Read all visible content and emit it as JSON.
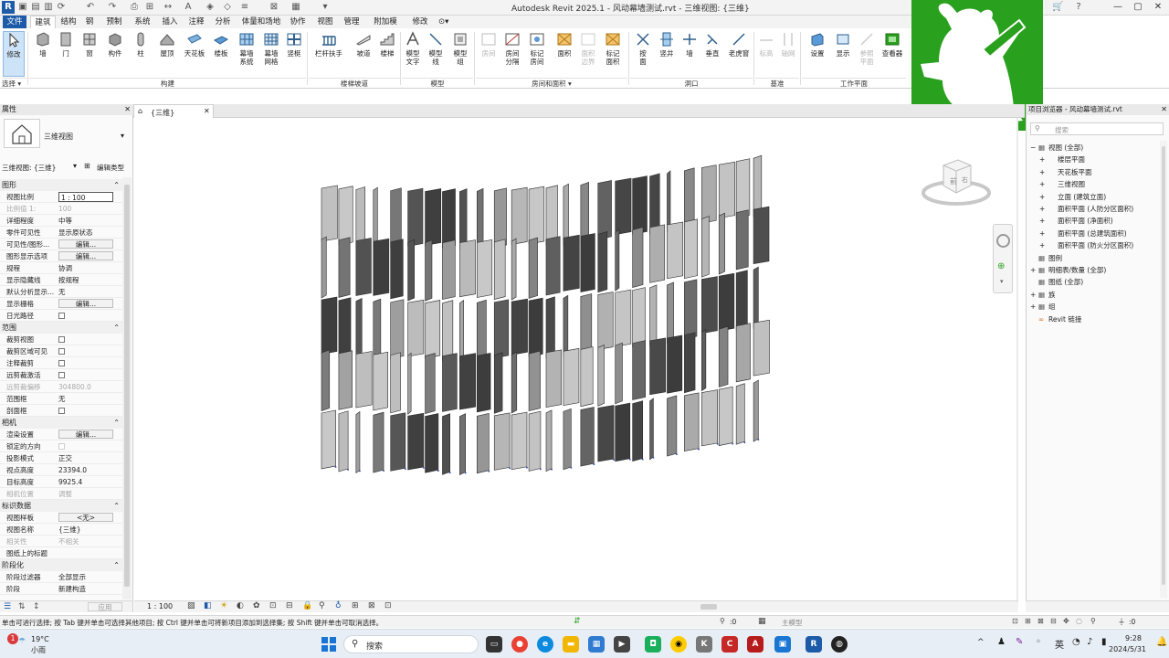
{
  "window": {
    "title": "Autodesk Revit 2025.1 - 风动幕墙测试.rvt - 三维视图: {三维}"
  },
  "menu": {
    "tabs": [
      "文件",
      "建筑",
      "结构",
      "钢",
      "预制",
      "系统",
      "插入",
      "注释",
      "分析",
      "体量和场地",
      "协作",
      "视图",
      "管理",
      "附加模块",
      "修改"
    ]
  },
  "ribbon": {
    "buttons": [
      {
        "label": "修改"
      },
      {
        "label": "墙"
      },
      {
        "label": "门"
      },
      {
        "label": "窗"
      },
      {
        "label": "构件"
      },
      {
        "label": "柱"
      },
      {
        "label": "屋顶"
      },
      {
        "label": "天花板"
      },
      {
        "label": "楼板"
      },
      {
        "label": "幕墙\n系统"
      },
      {
        "label": "幕墙\n网格"
      },
      {
        "label": "竖梃"
      },
      {
        "label": "栏杆扶手"
      },
      {
        "label": "坡道"
      },
      {
        "label": "楼梯"
      },
      {
        "label": "模型\n文字"
      },
      {
        "label": "模型\n线"
      },
      {
        "label": "模型\n组"
      },
      {
        "label": "房间"
      },
      {
        "label": "房间\n分隔"
      },
      {
        "label": "标记\n房间"
      },
      {
        "label": "面积"
      },
      {
        "label": "面积\n边界"
      },
      {
        "label": "标记\n面积"
      },
      {
        "label": "按\n面"
      },
      {
        "label": "竖井"
      },
      {
        "label": "墙"
      },
      {
        "label": "垂直"
      },
      {
        "label": "老虎窗"
      },
      {
        "label": "标高"
      },
      {
        "label": "轴网"
      },
      {
        "label": "设置"
      },
      {
        "label": "显示"
      },
      {
        "label": "参照\n平面"
      },
      {
        "label": "查看器"
      }
    ],
    "panels": [
      {
        "label": "选择 ▾"
      },
      {
        "label": "构建"
      },
      {
        "label": "楼梯坡道"
      },
      {
        "label": "模型"
      },
      {
        "label": "房间和面积 ▾"
      },
      {
        "label": "洞口"
      },
      {
        "label": "基准"
      },
      {
        "label": "工作平面"
      }
    ]
  },
  "properties": {
    "header": "属性",
    "type_name": "三维视图",
    "selector_label": "三维视图: {三维}",
    "edit_type": "编辑类型",
    "groups": [
      {
        "name": "图形",
        "rows": [
          {
            "k": "视图比例",
            "v": "1 : 100",
            "kind": "box"
          },
          {
            "k": "比例值 1:",
            "v": "100",
            "kind": "dis"
          },
          {
            "k": "详细程度",
            "v": "中等"
          },
          {
            "k": "零件可见性",
            "v": "显示原状态"
          },
          {
            "k": "可见性/图形...",
            "v": "编辑...",
            "kind": "btn"
          },
          {
            "k": "图形显示选项",
            "v": "编辑...",
            "kind": "btn"
          },
          {
            "k": "规程",
            "v": "协调"
          },
          {
            "k": "显示隐藏线",
            "v": "按规程"
          },
          {
            "k": "默认分析显示...",
            "v": "无"
          },
          {
            "k": "显示栅格",
            "v": "编辑...",
            "kind": "btn"
          },
          {
            "k": "日光路径",
            "v": "",
            "kind": "cb"
          }
        ]
      },
      {
        "name": "范围",
        "rows": [
          {
            "k": "裁剪视图",
            "v": "",
            "kind": "cb"
          },
          {
            "k": "裁剪区域可见",
            "v": "",
            "kind": "cb"
          },
          {
            "k": "注释裁剪",
            "v": "",
            "kind": "cb"
          },
          {
            "k": "远剪裁激活",
            "v": "",
            "kind": "cb"
          },
          {
            "k": "远剪裁偏移",
            "v": "304800.0",
            "kind": "dis"
          },
          {
            "k": "范围框",
            "v": "无"
          },
          {
            "k": "剖面框",
            "v": "",
            "kind": "cb"
          }
        ]
      },
      {
        "name": "相机",
        "rows": [
          {
            "k": "渲染设置",
            "v": "编辑...",
            "kind": "btn"
          },
          {
            "k": "锁定的方向",
            "v": "",
            "kind": "cbdis"
          },
          {
            "k": "投影模式",
            "v": "正交"
          },
          {
            "k": "视点高度",
            "v": "23394.0"
          },
          {
            "k": "目标高度",
            "v": "9925.4"
          },
          {
            "k": "相机位置",
            "v": "调整",
            "kind": "dis"
          }
        ]
      },
      {
        "name": "标识数据",
        "rows": [
          {
            "k": "视图样板",
            "v": "<无>",
            "kind": "btn"
          },
          {
            "k": "视图名称",
            "v": "{三维}"
          },
          {
            "k": "相关性",
            "v": "不相关",
            "kind": "dis"
          },
          {
            "k": "图纸上的标题",
            "v": ""
          }
        ]
      },
      {
        "name": "阶段化",
        "rows": [
          {
            "k": "阶段过滤器",
            "v": "全部显示"
          },
          {
            "k": "阶段",
            "v": "新建构造"
          }
        ]
      }
    ],
    "help_link": "属性帮助",
    "apply": "应用"
  },
  "view": {
    "tab_label": "{三维}",
    "scale": "1 : 100"
  },
  "browser": {
    "title": "项目浏览器 - 风动幕墙测试.rvt",
    "search_placeholder": "搜索",
    "items": [
      {
        "label": "视图 (全部)",
        "level": 0,
        "toggle": "−"
      },
      {
        "label": "楼层平面",
        "level": 1,
        "toggle": "+"
      },
      {
        "label": "天花板平面",
        "level": 1,
        "toggle": "+"
      },
      {
        "label": "三维视图",
        "level": 1,
        "toggle": "+"
      },
      {
        "label": "立面 (建筑立面)",
        "level": 1,
        "toggle": "+"
      },
      {
        "label": "面积平面 (人防分区面积)",
        "level": 1,
        "toggle": "+"
      },
      {
        "label": "面积平面 (净面积)",
        "level": 1,
        "toggle": "+"
      },
      {
        "label": "面积平面 (总建筑面积)",
        "level": 1,
        "toggle": "+"
      },
      {
        "label": "面积平面 (防火分区面积)",
        "level": 1,
        "toggle": "+"
      },
      {
        "label": "图例",
        "level": 0,
        "toggle": ""
      },
      {
        "label": "明细表/数量 (全部)",
        "level": 0,
        "toggle": "+"
      },
      {
        "label": "图纸 (全部)",
        "level": 0,
        "toggle": ""
      },
      {
        "label": "族",
        "level": 0,
        "toggle": "+"
      },
      {
        "label": "组",
        "level": 0,
        "toggle": "+"
      },
      {
        "label": "Revit 链接",
        "level": 0,
        "toggle": ""
      }
    ]
  },
  "status": {
    "message": "单击可进行选择; 按 Tab 键并单击可选择其他项目; 按 Ctrl 键并单击可将新项目添加到选择集; 按 Shift 键并单击可取消选择。",
    "filter_count": ":0",
    "model": "主模型",
    "select_count": ":0"
  },
  "taskbar": {
    "weather_temp": "19°C",
    "weather_desc": "小雨",
    "notif_badge": "1",
    "search_label": "搜索",
    "ime": "英",
    "time": "9:28",
    "date": "2024/5/31"
  },
  "colors": {
    "revit_blue": "#1d5aa8",
    "logo_green": "#2aa11e",
    "selection": "#cde3f7"
  }
}
